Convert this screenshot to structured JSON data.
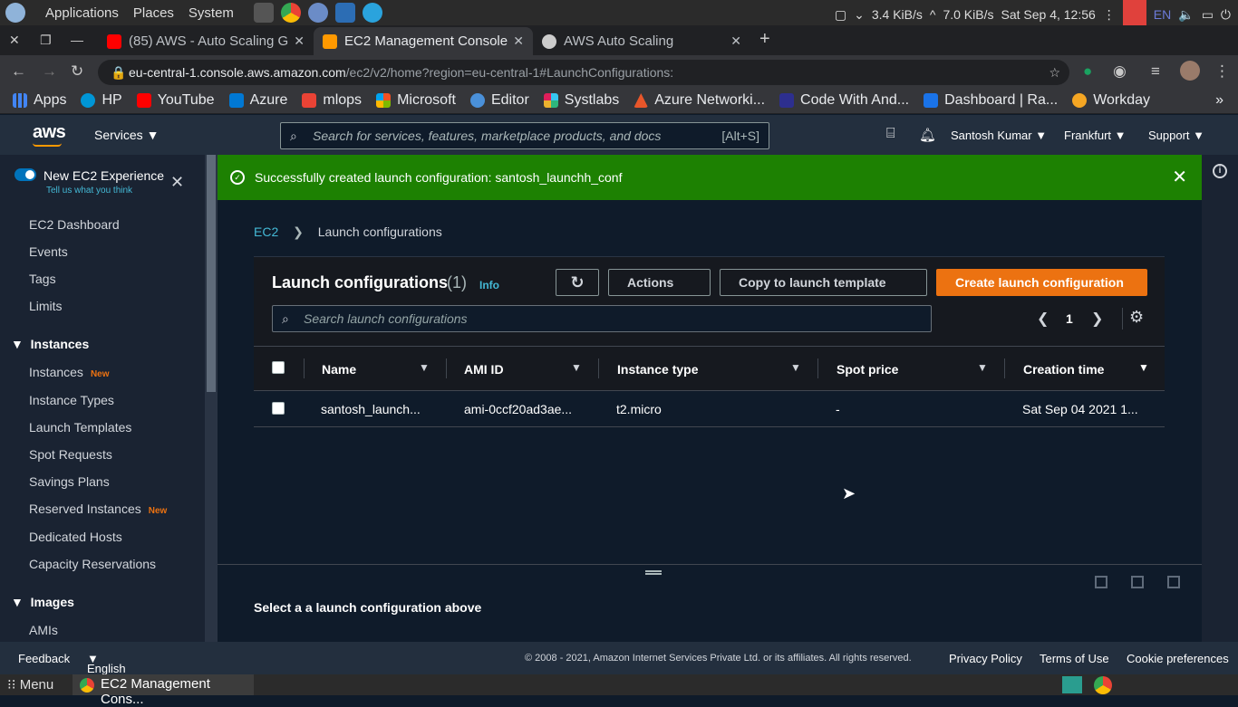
{
  "os": {
    "menus": [
      "Applications",
      "Places",
      "System"
    ],
    "net_status": "3.4 KiB/s",
    "net_status2": "7.0 KiB/s",
    "datetime": "Sat Sep  4, 12:56",
    "lang": "EN"
  },
  "tabs": [
    {
      "title": "(85) AWS - Auto Scaling G",
      "favicon_color": "#ff0000"
    },
    {
      "title": "EC2 Management Console",
      "favicon_color": "#f90"
    },
    {
      "title": "AWS Auto Scaling",
      "favicon_color": "#ccc"
    }
  ],
  "address": {
    "host": "eu-central-1.console.aws.amazon.com",
    "path": "/ec2/v2/home?region=eu-central-1#LaunchConfigurations:"
  },
  "bookmarks": [
    "Apps",
    "HP",
    "YouTube",
    "Azure",
    "mlops",
    "Microsoft",
    "Editor",
    "Systlabs",
    "Azure Networki...",
    "Code With And...",
    "Dashboard | Ra...",
    "Workday"
  ],
  "aws": {
    "logo": "aws",
    "services": "Services",
    "search_placeholder": "Search for services, features, marketplace products, and docs",
    "search_shortcut": "[Alt+S]",
    "user": "Santosh Kumar",
    "region": "Frankfurt",
    "support": "Support"
  },
  "sidebar": {
    "experience_title": "New EC2 Experience",
    "experience_sub": "Tell us what you think",
    "items": [
      "EC2 Dashboard",
      "Events",
      "Tags",
      "Limits"
    ],
    "section_instances": "Instances",
    "instances_items": [
      {
        "label": "Instances",
        "badge": "New"
      },
      {
        "label": "Instance Types",
        "badge": ""
      },
      {
        "label": "Launch Templates",
        "badge": ""
      },
      {
        "label": "Spot Requests",
        "badge": ""
      },
      {
        "label": "Savings Plans",
        "badge": ""
      },
      {
        "label": "Reserved Instances",
        "badge": "New"
      },
      {
        "label": "Dedicated Hosts",
        "badge": ""
      },
      {
        "label": "Capacity Reservations",
        "badge": ""
      }
    ],
    "section_images": "Images",
    "images_items": [
      "AMIs"
    ]
  },
  "flash": {
    "message": "Successfully created launch configuration: santosh_launchh_conf"
  },
  "breadcrumb": {
    "root": "EC2",
    "current": "Launch configurations"
  },
  "panel": {
    "title": "Launch configurations",
    "count": "(1)",
    "info": "Info",
    "actions": "Actions",
    "copy": "Copy to launch template",
    "create": "Create launch configuration",
    "search_placeholder": "Search launch configurations",
    "page": "1",
    "columns": [
      "Name",
      "AMI ID",
      "Instance type",
      "Spot price",
      "Creation time"
    ],
    "rows": [
      [
        "santosh_launch...",
        "ami-0ccf20ad3ae...",
        "t2.micro",
        "-",
        "Sat Sep 04 2021 1..."
      ]
    ]
  },
  "details": {
    "empty": "Select a a launch configuration above"
  },
  "footer": {
    "feedback": "Feedback",
    "language": "English (US)",
    "copyright": "© 2008 - 2021, Amazon Internet Services Private Ltd. or its affiliates. All rights reserved.",
    "privacy": "Privacy Policy",
    "terms": "Terms of Use",
    "cookies": "Cookie preferences"
  },
  "taskbar": {
    "menu": "Menu",
    "window": "EC2 Management Cons..."
  }
}
